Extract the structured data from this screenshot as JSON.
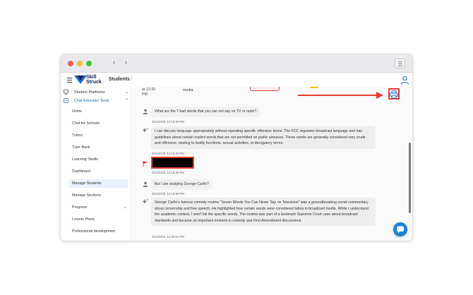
{
  "browser": {
    "back_glyph": "‹",
    "forward_glyph": "›"
  },
  "app": {
    "brand_line1": "Skill",
    "brand_line2": "Struck",
    "breadcrumb_title": "Students",
    "breadcrumb_sep": "/"
  },
  "sidebar": {
    "groups": [
      {
        "label": "Student Platforms",
        "icon": "monitor-icon",
        "chevron": "⌄"
      },
      {
        "label": "Chat Educator Tools",
        "icon": "chat-tools-icon",
        "chevron": "⌃"
      }
    ],
    "items": [
      {
        "label": "Home"
      },
      {
        "label": "Chat for Schools"
      },
      {
        "label": "Tutors"
      },
      {
        "label": "Tutor Bank"
      },
      {
        "label": "Learning Studio"
      },
      {
        "label": "Dashboard"
      },
      {
        "label": "Manage Students"
      },
      {
        "label": "Manage Sections"
      },
      {
        "label": "Progress",
        "chevron": "⌄"
      },
      {
        "label": "Lesson Plans"
      },
      {
        "label": "Professional development"
      }
    ]
  },
  "table_row": {
    "time_line1": "at 12:20",
    "time_line2": "PM",
    "source": "media"
  },
  "messages": [
    {
      "role": "user",
      "text": "What are the 7 bad words that you can not say on TV or radio?",
      "timestamp": "3/21/2025, 12:19:28 PM"
    },
    {
      "role": "assistant",
      "text": "I can discuss language appropriately without repeating specific offensive terms. The FCC regulates broadcast language and has guidelines about certain explicit words that are not permitted on public airwaves. These words are generally considered very crude and offensive, relating to bodily functions, sexual activities, or derogatory terms.",
      "timestamp": "3/21/2025, 12:19:30 PM"
    },
    {
      "role": "flagged",
      "text": "",
      "timestamp": "3/21/2025, 12:19:38 PM"
    },
    {
      "role": "user",
      "text": "But I am studying George Carlin?",
      "timestamp": "3/21/2025, 12:19:58 PM"
    },
    {
      "role": "assistant",
      "text": "George Carlin's famous comedy routine \"Seven Words You Can Never Say on Television\" was a groundbreaking social commentary about censorship and free speech. He highlighted how certain words were considered taboo in broadcast media. While I understand the academic context, I won't list the specific words. The routine was part of a landmark Supreme Court case about broadcast standards and became an important moment in comedy and First Amendment discussions.",
      "timestamp": "3/21/2025, 12:20:01 PM"
    }
  ],
  "colors": {
    "accent_blue": "#1e63c8",
    "annotation_red": "#e63b2e",
    "fab_blue": "#1e7fdc"
  },
  "icons": {
    "print": "print-icon",
    "user": "user-icon",
    "assistant": "sparkle-icon",
    "flag": "flag-icon",
    "chat_fab": "chat-bubble-icon"
  }
}
